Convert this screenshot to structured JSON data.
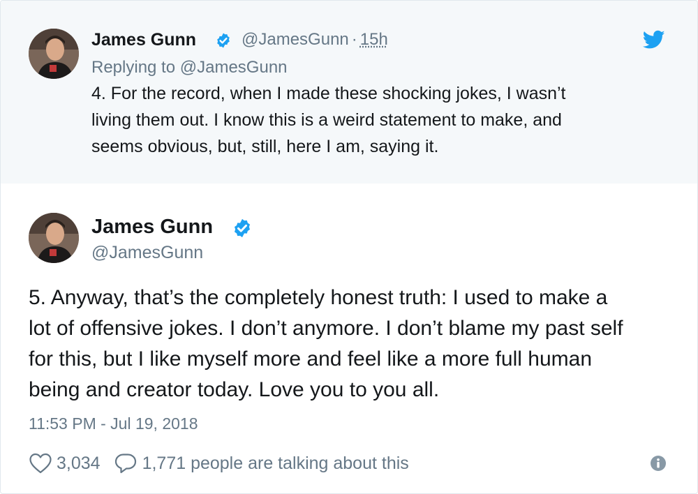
{
  "parent_tweet": {
    "author_name": "James Gunn",
    "handle": "@JamesGunn",
    "separator": "·",
    "time": "15h",
    "replying_prefix": "Replying to",
    "replying_to": "@JamesGunn",
    "text": "4. For the record, when I made these shocking jokes, I wasn’t\nliving them out. I know this is a weird statement to make, and\nseems obvious, but, still, here I am, saying it."
  },
  "main_tweet": {
    "author_name": "James Gunn",
    "handle": "@JamesGunn",
    "text": "5. Anyway, that’s the completely honest truth: I used to make a\nlot of offensive jokes. I don’t anymore. I don’t blame my past self\nfor this, but I like myself more and feel like a more full human\nbeing and creator today.  Love you to you all.",
    "timestamp": "11:53 PM - Jul 19, 2018",
    "likes": "3,034",
    "talking": "1,771 people are talking about this"
  },
  "colors": {
    "twitter_blue": "#1da1f2",
    "text_primary": "#14171a",
    "text_secondary": "#657786",
    "parent_background": "#f5f8fa"
  },
  "icons": [
    "verified-badge-icon",
    "twitter-bird-icon",
    "heart-icon",
    "reply-bubble-icon",
    "info-icon"
  ]
}
